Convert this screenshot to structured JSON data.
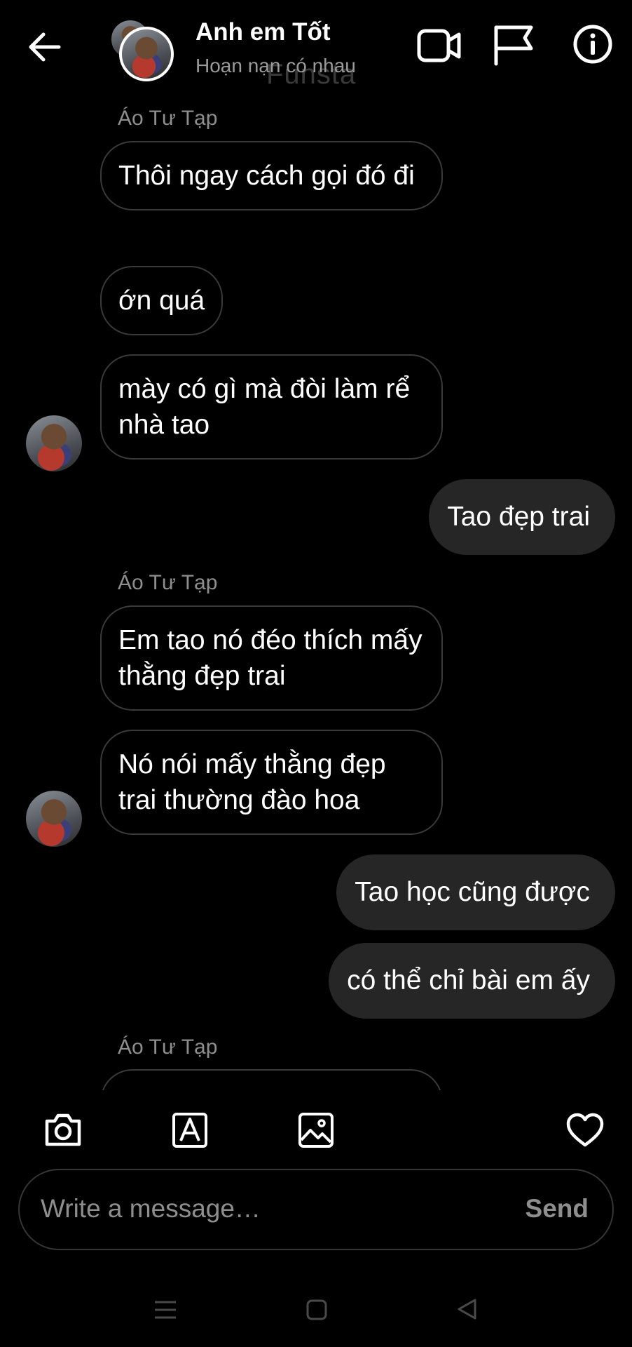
{
  "header": {
    "title": "Anh em Tốt",
    "subtitle": "Hoạn nạn có nhau",
    "watermark": "Funsta"
  },
  "messages": [
    {
      "direction": "in",
      "sender": "Áo Tư Tạp",
      "text": "Thôi ngay cách gọi đó đi"
    },
    {
      "direction": "in",
      "text": "ớn quá"
    },
    {
      "direction": "in",
      "text": "mày có gì mà đòi làm rể nhà tao"
    },
    {
      "direction": "out",
      "text": "Tao đẹp trai"
    },
    {
      "direction": "in",
      "sender": "Áo Tư Tạp",
      "text": "Em tao nó đéo thích mấy thằng đẹp trai"
    },
    {
      "direction": "in",
      "text": "Nó nói mấy thằng đẹp trai thường đào hoa"
    },
    {
      "direction": "out",
      "text": "Tao học cũng được"
    },
    {
      "direction": "out",
      "text": "có thể chỉ bài em ấy"
    },
    {
      "direction": "in",
      "sender": "Áo Tư Tạp",
      "text": ""
    }
  ],
  "composer": {
    "placeholder": "Write a message…",
    "send_label": "Send"
  },
  "icons": {
    "back": "arrow-left-icon",
    "video": "video-camera-icon",
    "flag": "flag-icon",
    "info": "info-icon",
    "camera": "camera-icon",
    "sticker": "text-a-icon",
    "gallery": "image-icon",
    "like": "heart-icon"
  }
}
